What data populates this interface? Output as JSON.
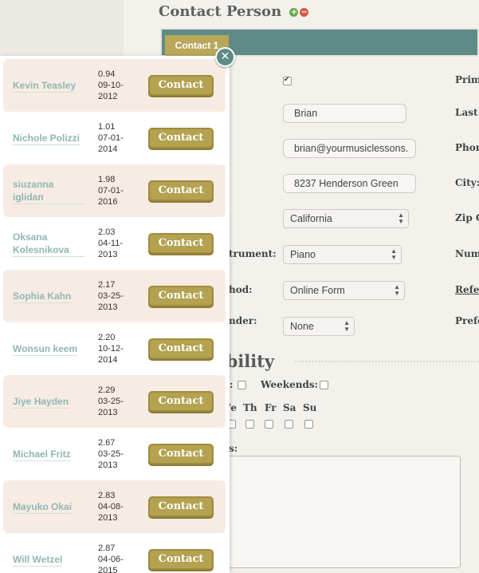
{
  "header": {
    "title": "Contact Person",
    "add_icon": "plus-circle-icon",
    "remove_icon": "minus-circle-icon",
    "add_glyph": "+",
    "remove_glyph": "−"
  },
  "tabs": [
    {
      "label": "Contact 1"
    }
  ],
  "form": {
    "first_name": "Brian",
    "email": "brian@yourmusiclessons.",
    "address": "8237 Henderson Green",
    "state": "California",
    "instrument_label": "trument:",
    "instrument": "Piano",
    "method_label": "hod:",
    "method": "Online Form",
    "reminder_label": "nder:",
    "reminder": "None",
    "right_labels": [
      "Prim",
      "Last",
      "Phon",
      "City:",
      "Zip C",
      "Num",
      "Refer",
      "Prefe"
    ]
  },
  "availability": {
    "title": "ability",
    "weekdays_label": ":",
    "weekends_label": "Weekends:",
    "days": [
      "/e",
      "Th",
      "Fr",
      "Sa",
      "Su"
    ],
    "notes_label": "s:"
  },
  "colors": {
    "accent": "#5f8b87",
    "button": "#b4a250",
    "row_shade": "#f7ece4",
    "name_link": "#8fb7b3"
  },
  "popup": {
    "close_glyph": "✕",
    "contact_label": "Contact",
    "rows": [
      {
        "name": "Kevin Teasley",
        "score": "0.94",
        "date": "09-10-",
        "year": "2012"
      },
      {
        "name": "Nichole Polizzi",
        "score": "1.01",
        "date": "07-01-",
        "year": "2014"
      },
      {
        "name": "siuzanna iglidan",
        "score": "1.98",
        "date": "07-01-",
        "year": "2016"
      },
      {
        "name": "Oksana Kolesnikova",
        "score": "2.03",
        "date": "04-11-",
        "year": "2013"
      },
      {
        "name": "Sophia Kahn",
        "score": "2.17",
        "date": "03-25-",
        "year": "2013"
      },
      {
        "name": "Wonsun keem",
        "score": "2.20",
        "date": "10-12-",
        "year": "2014"
      },
      {
        "name": "Jiye Hayden",
        "score": "2.29",
        "date": "03-25-",
        "year": "2013"
      },
      {
        "name": "Michael Fritz",
        "score": "2.67",
        "date": "03-25-",
        "year": "2013"
      },
      {
        "name": "Mayuko Okai",
        "score": "2.83",
        "date": "04-08-",
        "year": "2013"
      },
      {
        "name": "Will Wetzel",
        "score": "2.87",
        "date": "04-06-",
        "year": "2015"
      }
    ]
  }
}
